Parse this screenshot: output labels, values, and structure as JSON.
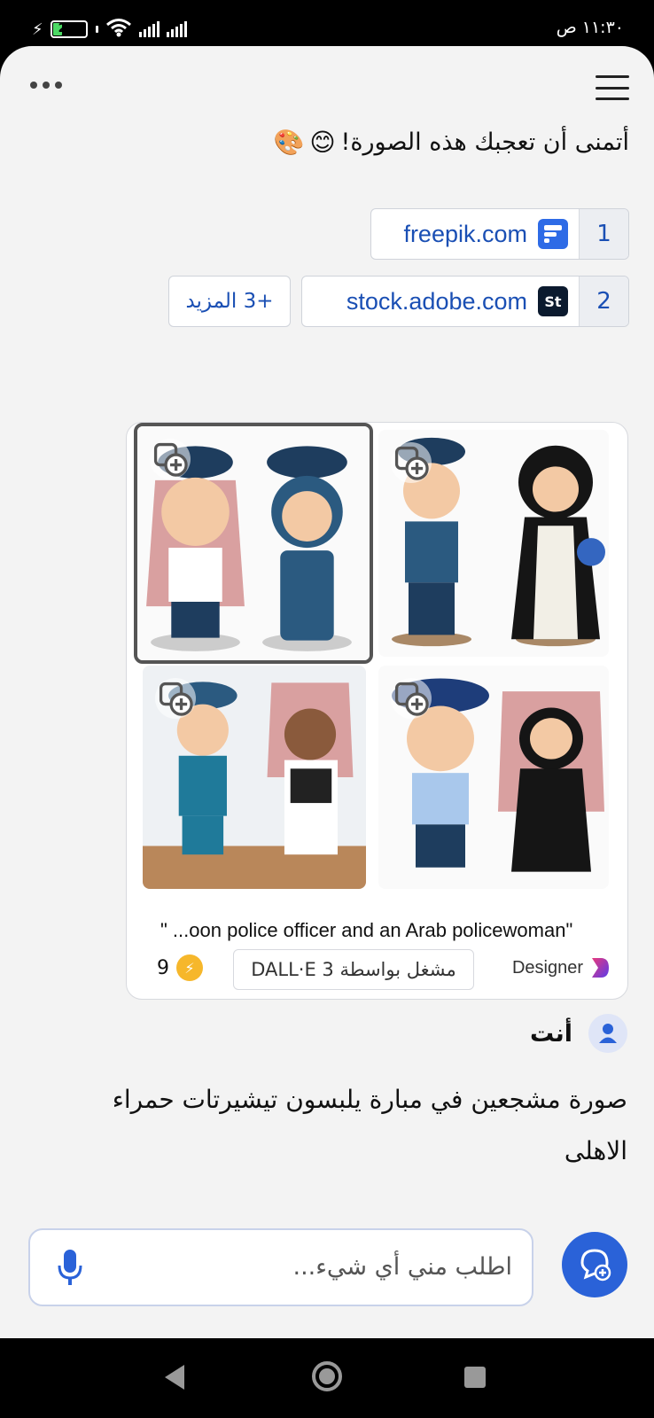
{
  "status_bar": {
    "time": "١١:٣٠ ص",
    "battery_level": "29",
    "battery_fraction": 0.29
  },
  "assistant_message": {
    "text": "أتمنى أن تعجبك هذه الصورة!",
    "emojis": [
      "😊",
      "🎨"
    ]
  },
  "citations": [
    {
      "number": "1",
      "domain": "freepik.com",
      "icon": "freepik-icon",
      "color": "#2e6be6"
    },
    {
      "number": "2",
      "domain": "stock.adobe.com",
      "icon": "adobe-stock-icon",
      "color": "#0b1a2e",
      "icon_text": "St"
    }
  ],
  "more_citations_label": "+3 المزيد",
  "image_card": {
    "images": [
      {
        "name": "image-police-gulf-officers",
        "selected": true
      },
      {
        "name": "image-police-officer-abaya-woman",
        "selected": false
      },
      {
        "name": "image-armed-officers",
        "selected": false
      },
      {
        "name": "image-officer-and-niqab-woman",
        "selected": false
      }
    ],
    "caption": "\" ...oon police officer and an Arab policewoman\"",
    "credits": "9",
    "powered_by": "مشغل بواسطة DALL·E 3",
    "designer_label": "Designer"
  },
  "user": {
    "name": "أنت",
    "message": "صورة   مشجعين في مبارة يلبسون تيشيرتات حمراء الاهلى"
  },
  "composer": {
    "placeholder": "اطلب مني أي شيء..."
  },
  "colors": {
    "accent": "#2a62d8",
    "link": "#1a4fb4",
    "background": "#f3f3f3"
  }
}
